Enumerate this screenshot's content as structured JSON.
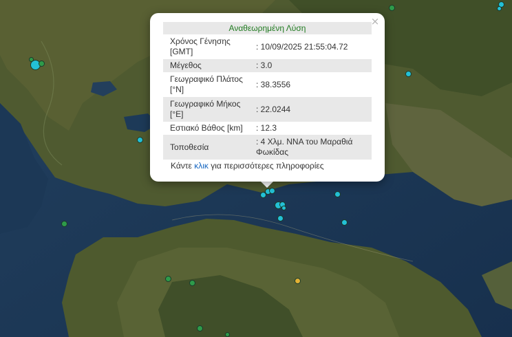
{
  "popup": {
    "title": "Αναθεωρημένη Λύση",
    "close_symbol": "×",
    "rows": [
      {
        "label": "Χρόνος Γένησης [GMT]",
        "value": ": 10/09/2025 21:55:04.72"
      },
      {
        "label": "Μέγεθος",
        "value": ": 3.0"
      },
      {
        "label": "Γεωγραφικό Πλάτος [°N]",
        "value": ": 38.3556"
      },
      {
        "label": "Γεωγραφικό Μήκος [°E]",
        "value": ": 22.0244"
      },
      {
        "label": "Εστιακό Βάθος [km]",
        "value": ": 12.3"
      },
      {
        "label": "Τοποθεσία",
        "value": ": 4 Χλμ. ΝΝΑ του Μαραθιά Φωκίδας"
      }
    ],
    "footer_before": "Κάντε",
    "footer_link": "κλικ",
    "footer_after": "για περισσότερες πληροφορίες"
  },
  "colors": {
    "recent_quake": "#23c0d6",
    "older_quake": "#2e9b4a",
    "mid_quake": "#e2b134",
    "sea": "#1f3a5a",
    "land": "#4e5a2e"
  }
}
